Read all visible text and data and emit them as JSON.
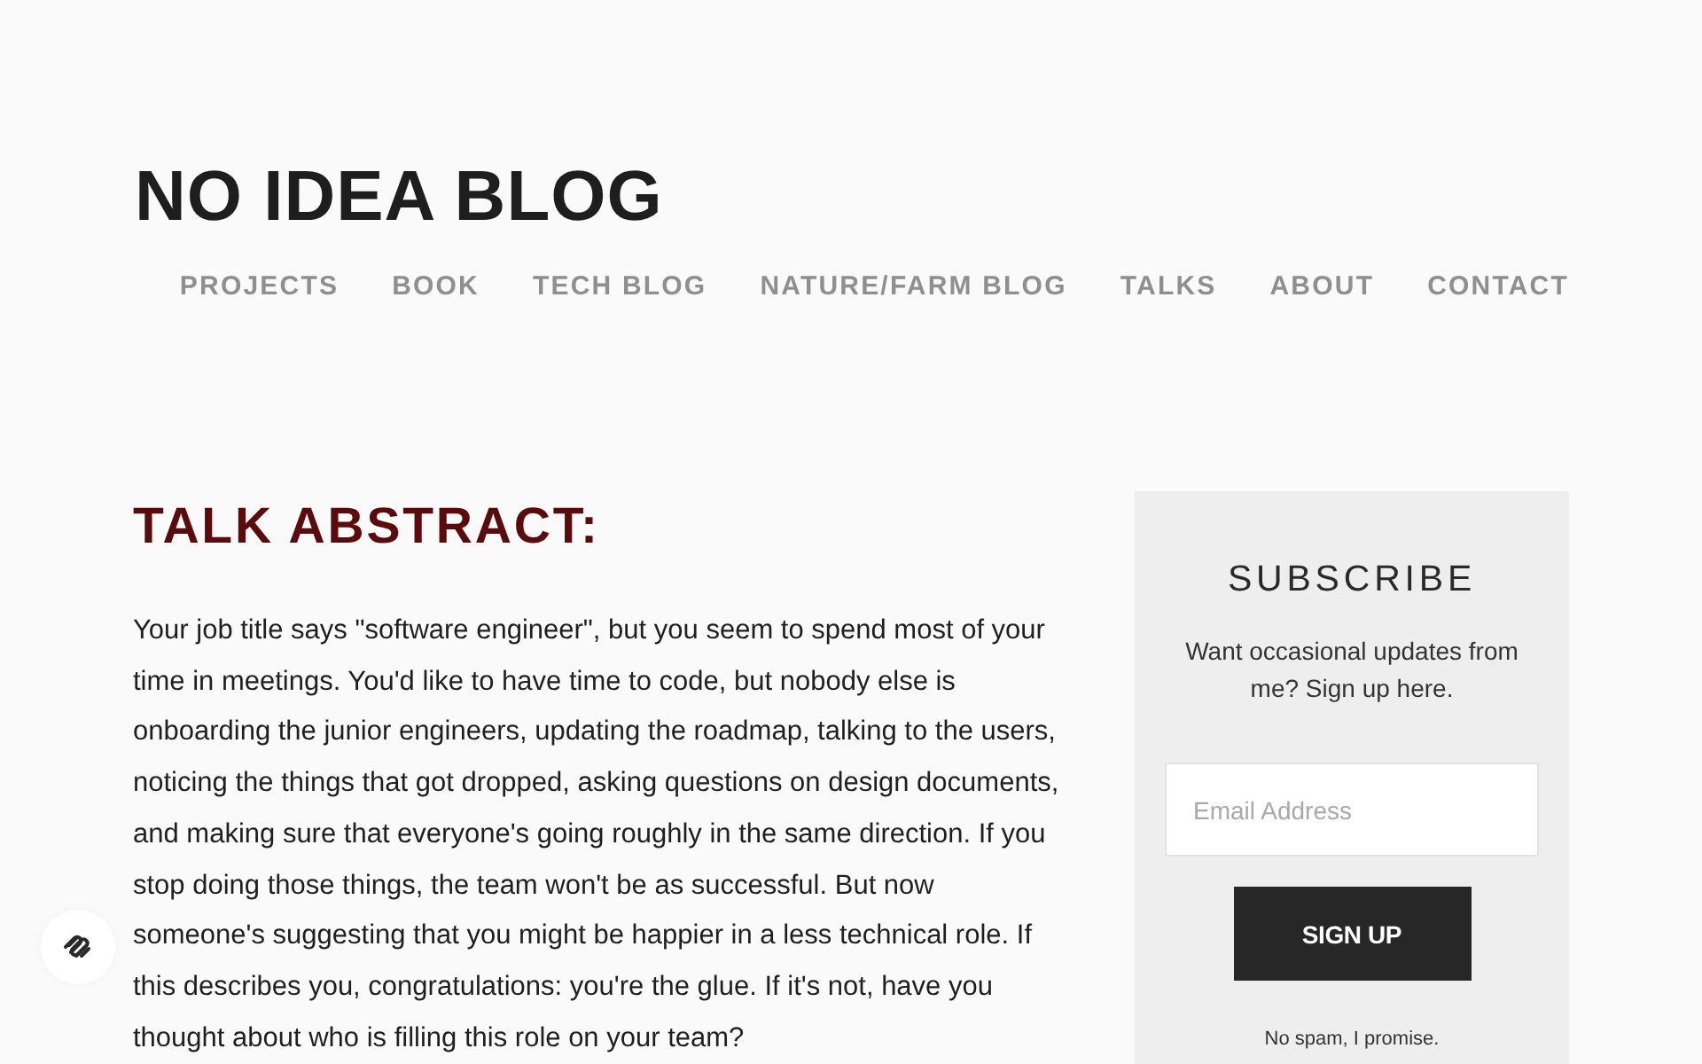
{
  "site": {
    "title": "NO IDEA BLOG"
  },
  "nav": [
    {
      "label": "PROJECTS"
    },
    {
      "label": "BOOK"
    },
    {
      "label": "TECH BLOG"
    },
    {
      "label": "NATURE/FARM BLOG"
    },
    {
      "label": "TALKS"
    },
    {
      "label": "ABOUT"
    },
    {
      "label": "CONTACT"
    }
  ],
  "article": {
    "heading": "TALK ABSTRACT:",
    "body": "Your job title says \"software engineer\", but you seem to spend most of your time in meetings. You'd like to have time to code, but nobody else is onboarding the junior engineers, updating the roadmap, talking to the users, noticing the things that got dropped, asking questions on design documents, and making sure that everyone's going roughly in the same direction. If you stop doing those things, the team won't be as successful. But now someone's suggesting that you might be happier in a less technical role. If this describes you, congratulations: you're the glue. If it's not, have you thought about who is filling this role on your team?"
  },
  "subscribe": {
    "title": "SUBSCRIBE",
    "description": "Want occasional updates from me? Sign up here.",
    "email_field": {
      "placeholder": "Email Address"
    },
    "button": "SIGN UP",
    "note": "No spam, I promise."
  }
}
